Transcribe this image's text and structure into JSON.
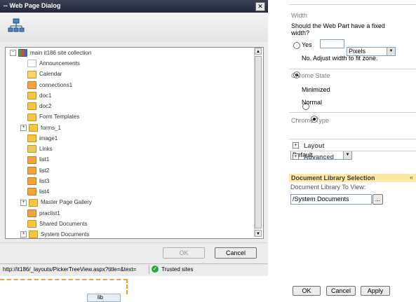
{
  "dialog": {
    "title": "-- Web Page Dialog",
    "close_glyph": "✕",
    "ok_label": "OK",
    "cancel_label": "Cancel",
    "status_url": "http://it186/_layouts/PickerTreeView.aspx?title=&text=",
    "status_zone": "Trusted sites",
    "tree": {
      "root": "main it186 site collection",
      "items": [
        {
          "label": "Announcements",
          "icon": "announcements-icon",
          "expandable": false
        },
        {
          "label": "Calendar",
          "icon": "calendar-icon",
          "expandable": false
        },
        {
          "label": "connections1",
          "icon": "list-icon",
          "expandable": false
        },
        {
          "label": "doc1",
          "icon": "folder-icon",
          "expandable": false
        },
        {
          "label": "doc2",
          "icon": "folder-icon",
          "expandable": false
        },
        {
          "label": "Form Templates",
          "icon": "folder-icon",
          "expandable": false
        },
        {
          "label": "forms_1",
          "icon": "folder-icon",
          "expandable": true
        },
        {
          "label": "image1",
          "icon": "folder-icon",
          "expandable": false
        },
        {
          "label": "Links",
          "icon": "links-icon",
          "expandable": false
        },
        {
          "label": "list1",
          "icon": "list-icon",
          "expandable": false
        },
        {
          "label": "list2",
          "icon": "list-icon",
          "expandable": false
        },
        {
          "label": "list3",
          "icon": "list-icon",
          "expandable": false
        },
        {
          "label": "list4",
          "icon": "list-icon",
          "expandable": false
        },
        {
          "label": "Master Page Gallery",
          "icon": "folder-icon",
          "expandable": true
        },
        {
          "label": "praclist1",
          "icon": "list-icon",
          "expandable": false
        },
        {
          "label": "Shared Documents",
          "icon": "folder-icon",
          "expandable": false
        },
        {
          "label": "System Documents",
          "icon": "folder-icon",
          "expandable": true
        }
      ]
    }
  },
  "tool_pane": {
    "width_heading": "Width",
    "fixed_width_question": "Should the Web Part have a fixed width?",
    "yes_label": "Yes",
    "unit_value": "Pixels",
    "no_label": "No. Adjust width to fit zone.",
    "chrome_state_heading": "Chrome State",
    "minimized_label": "Minimized",
    "normal_label": "Normal",
    "chrome_type_heading": "Chrome Type",
    "chrome_type_value": "Default",
    "layout_label": "Layout",
    "advanced_label": "Advanced",
    "doclib_heading": "Document Library Selection",
    "doclib_to_view_label": "Document Library To View:",
    "doclib_value": "/System Documents",
    "browse_label": "...",
    "ok_label": "OK",
    "cancel_label": "Cancel",
    "apply_label": "Apply"
  },
  "background": {
    "tab_label": "lib"
  }
}
